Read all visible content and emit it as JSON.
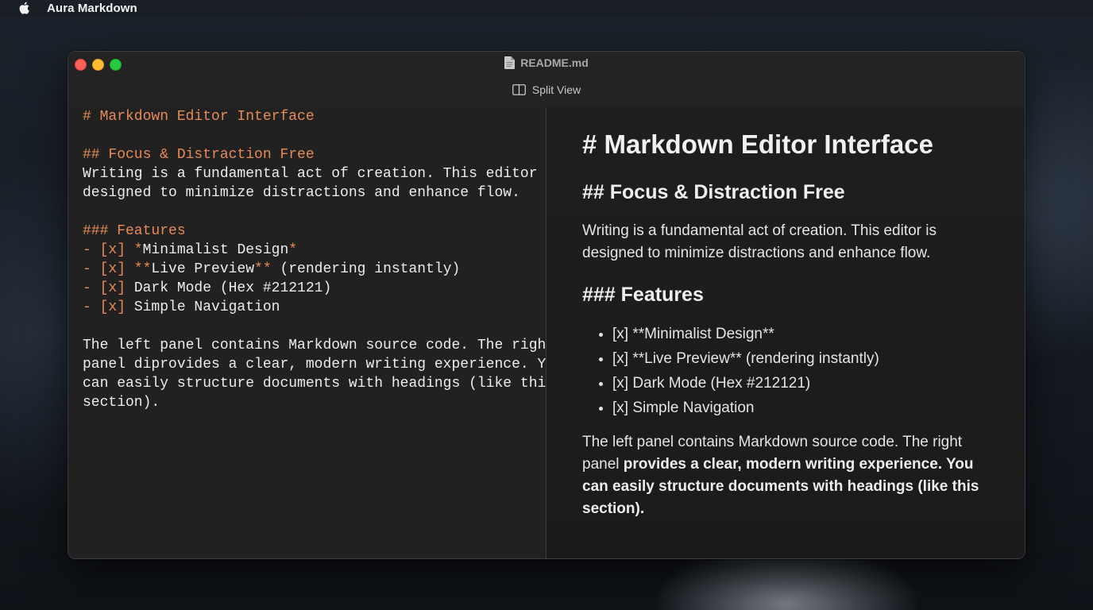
{
  "menubar": {
    "app_name": "Aura Markdown"
  },
  "window": {
    "title": "README.md",
    "view_mode_label": "Split View"
  },
  "editor": {
    "lines": [
      {
        "parts": [
          {
            "t": "# Markdown Editor Interface",
            "k": "h"
          }
        ]
      },
      {
        "parts": []
      },
      {
        "parts": [
          {
            "t": "## Focus & Distraction Free",
            "k": "h"
          }
        ]
      },
      {
        "parts": [
          {
            "t": "Writing is a fundamental act of creation. This editor is",
            "k": ""
          }
        ]
      },
      {
        "parts": [
          {
            "t": "designed to minimize distractions and enhance flow.",
            "k": ""
          }
        ]
      },
      {
        "parts": []
      },
      {
        "parts": [
          {
            "t": "### Features",
            "k": "h"
          }
        ]
      },
      {
        "parts": [
          {
            "t": "- [x] *",
            "k": "mk"
          },
          {
            "t": "Minimalist Design",
            "k": ""
          },
          {
            "t": "*",
            "k": "mk"
          }
        ]
      },
      {
        "parts": [
          {
            "t": "- [x] **",
            "k": "mk"
          },
          {
            "t": "Live Preview",
            "k": ""
          },
          {
            "t": "**",
            "k": "mk"
          },
          {
            "t": " (rendering instantly)",
            "k": ""
          }
        ]
      },
      {
        "parts": [
          {
            "t": "- [x] ",
            "k": "mk"
          },
          {
            "t": "Dark Mode (Hex #212121)",
            "k": ""
          }
        ]
      },
      {
        "parts": [
          {
            "t": "- [x] ",
            "k": "mk"
          },
          {
            "t": "Simple Navigation",
            "k": ""
          }
        ]
      },
      {
        "parts": []
      },
      {
        "parts": [
          {
            "t": "The left panel contains Markdown source code. The right",
            "k": ""
          }
        ]
      },
      {
        "parts": [
          {
            "t": "panel diprovides a clear, modern writing experience. You",
            "k": ""
          }
        ]
      },
      {
        "parts": [
          {
            "t": "can easily structure documents with headings (like this",
            "k": ""
          }
        ]
      },
      {
        "parts": [
          {
            "t": "section).",
            "k": ""
          }
        ]
      }
    ]
  },
  "preview": {
    "h1": "# Markdown Editor Interface",
    "h2": "## Focus & Distraction Free",
    "paragraph1": "Writing is a fundamental act of creation. This editor is designed to minimize distractions and enhance flow.",
    "h3": "### Features",
    "list": [
      "[x] **Minimalist Design**",
      "[x] **Live Preview** (rendering instantly)",
      "[x] Dark Mode (Hex #212121)",
      "[x] Simple Navigation"
    ],
    "paragraph2_plain": "The left panel contains Markdown source code. The right panel ",
    "paragraph2_bold": "provides a clear, modern writing experience. You can easily structure documents with headings (like this section)."
  },
  "colors": {
    "background": "#212121",
    "markdown_syntax": "#e88a55",
    "close": "#fe5f57",
    "minimize": "#febc2e",
    "maximize": "#28c840"
  },
  "icons": {
    "menubar": "apple-logo-icon",
    "title": "document-icon",
    "view_toggle": "split-view-icon"
  }
}
